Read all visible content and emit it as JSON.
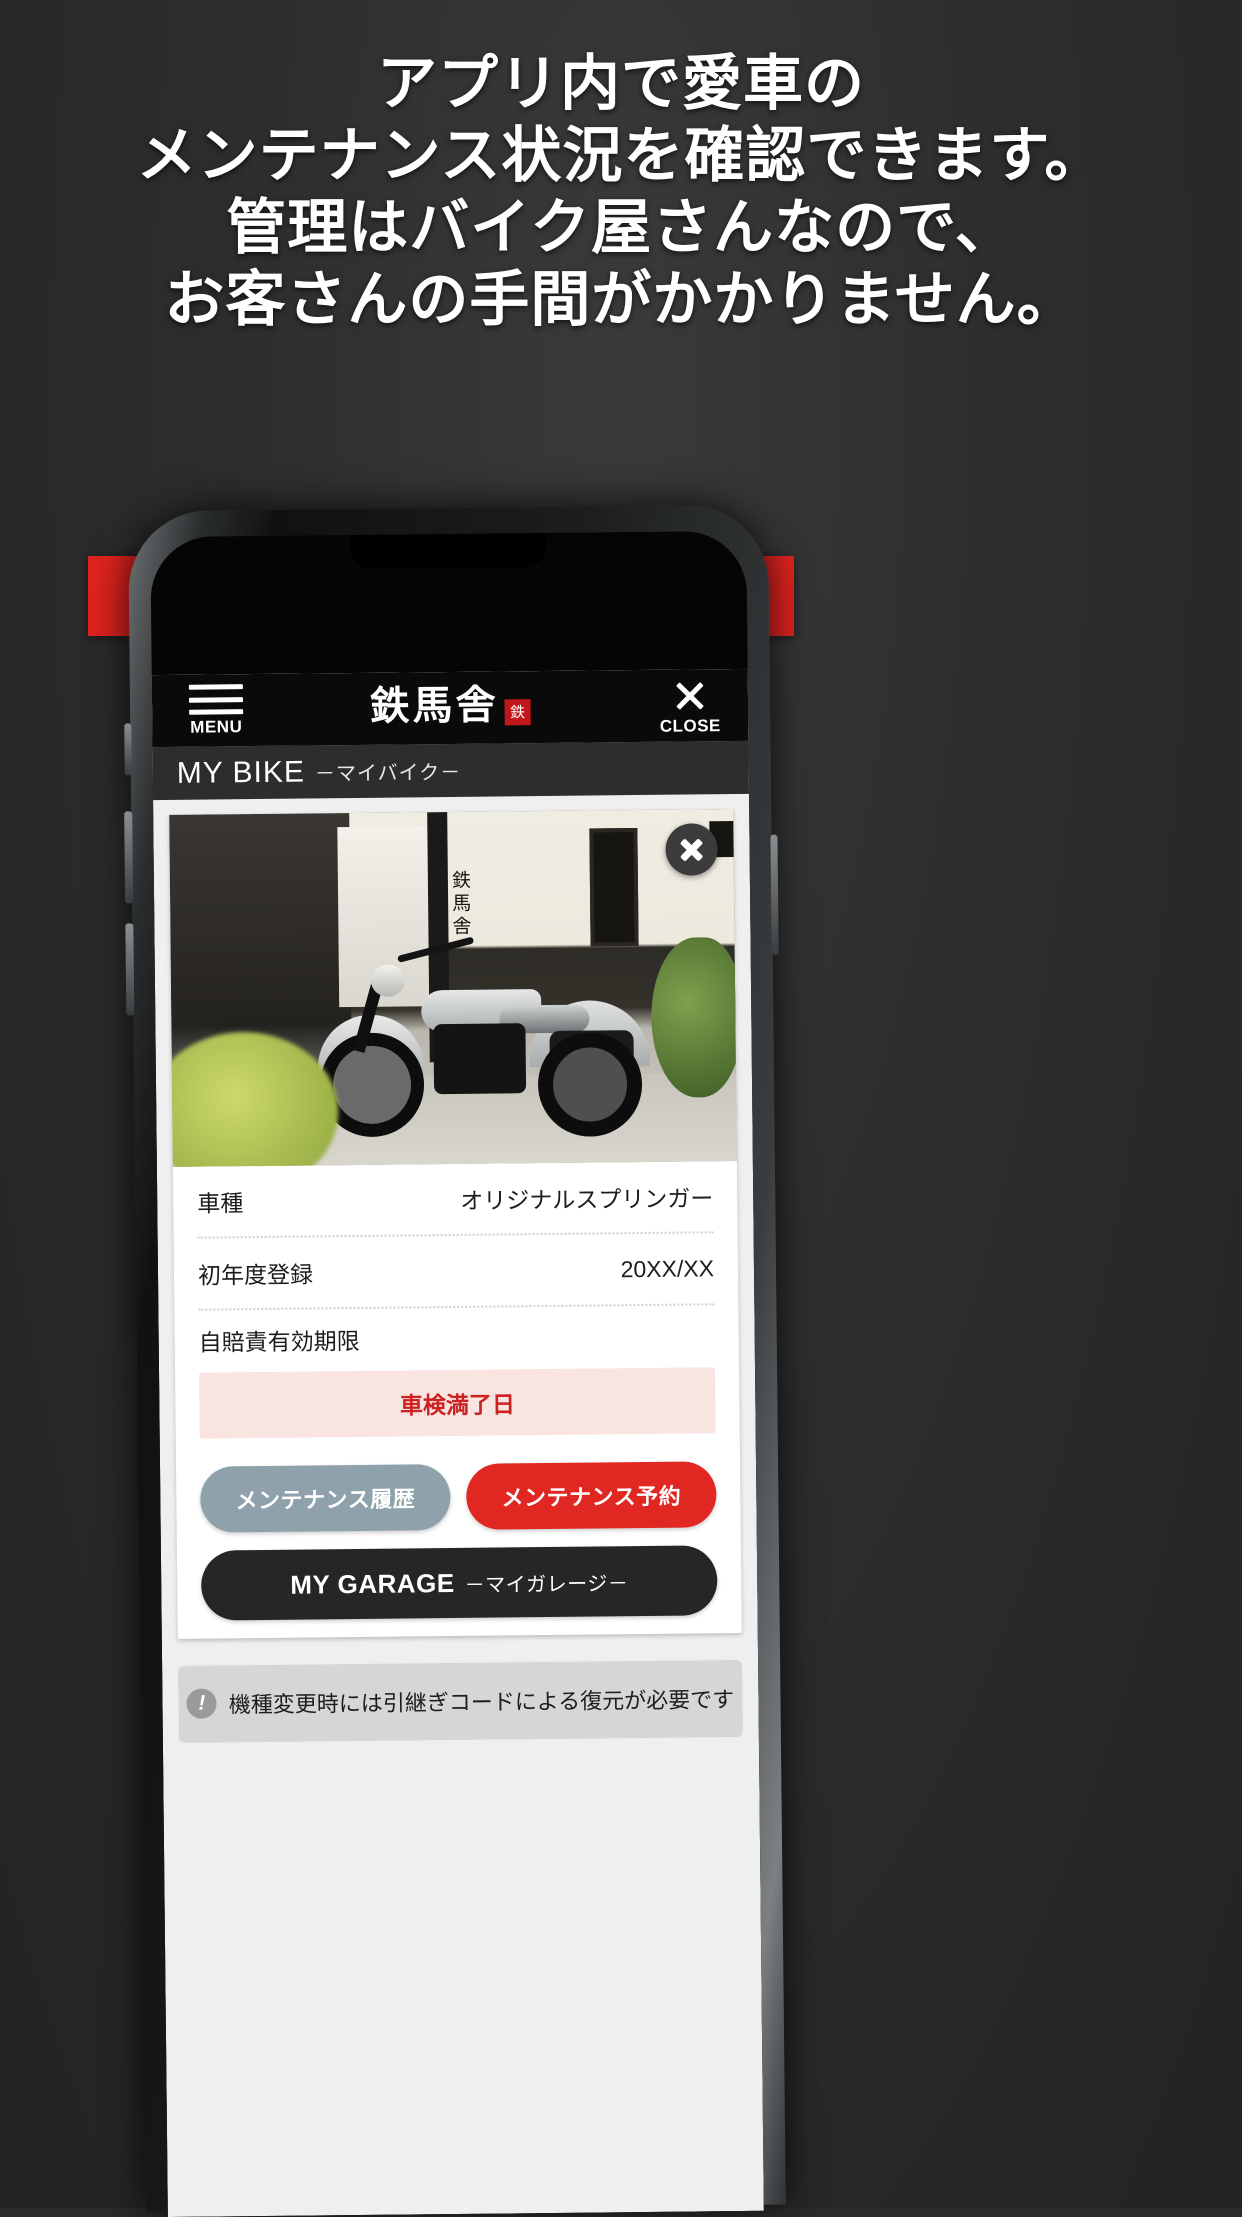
{
  "hero": {
    "lines": [
      "アプリ内で愛車の",
      "メンテナンス状況を確認できます。",
      "管理はバイク屋さんなので、",
      "お客さんの手間がかかりません。"
    ],
    "banner_label": "MY BIKE－マイバイク－",
    "banner_color": "#e0231f"
  },
  "app": {
    "appbar": {
      "menu_label": "MENU",
      "logo_text": "鉄馬舎",
      "logo_seal": "鉄",
      "close_label": "CLOSE"
    },
    "subbar": {
      "title": "MY BIKE",
      "subtitle": "－マイバイク－"
    },
    "photo": {
      "sign_text": "鉄馬舎",
      "close_icon": "close-circle"
    },
    "details": [
      {
        "label": "車種",
        "value": "オリジナルスプリンガー"
      },
      {
        "label": "初年度登録",
        "value": "20XX/XX"
      },
      {
        "label": "自賠責有効期限",
        "value": ""
      }
    ],
    "alert": {
      "text": "車検満了日",
      "text_color": "#cc2222",
      "bg_color": "#f9e4e2"
    },
    "buttons": {
      "history": "メンテナンス履歴",
      "history_color": "#8fa1ab",
      "reserve": "メンテナンス予約",
      "reserve_color": "#e12722",
      "garage_main": "MY GARAGE",
      "garage_sub": "－マイガレージ－",
      "garage_color": "#262626"
    },
    "notice": {
      "icon": "exclamation-icon",
      "text": "機種変更時には引継ぎコードによる復元が必要です"
    }
  }
}
